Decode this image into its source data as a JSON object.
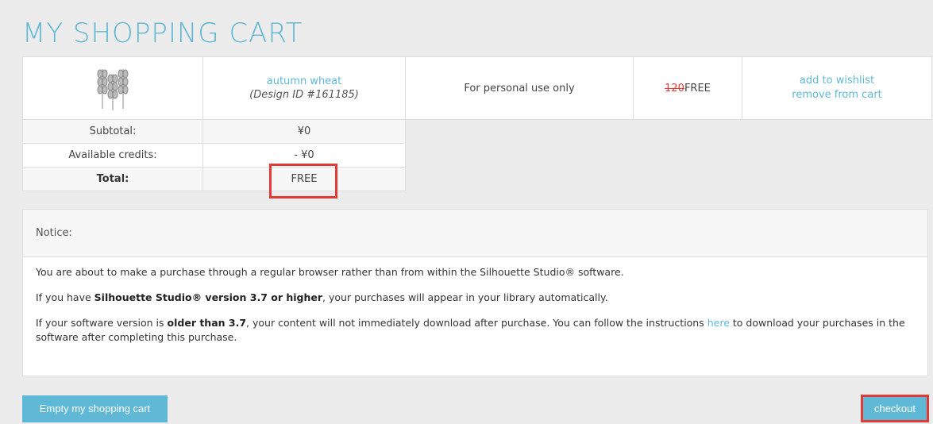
{
  "page": {
    "title": "MY SHOPPING CART"
  },
  "cart": {
    "item": {
      "thumbnail_icon": "wheat-icon",
      "name": "autumn wheat",
      "design_id": "(Design ID #161185)",
      "license": "For personal use only",
      "old_price": "120",
      "price": "FREE",
      "wishlist_link": "add to wishlist",
      "remove_link": "remove from cart"
    },
    "summary": {
      "subtotal_label": "Subtotal:",
      "subtotal_value": "¥0",
      "credits_label": "Available credits:",
      "credits_value": "- ¥0",
      "total_label": "Total:",
      "total_value": "FREE"
    }
  },
  "notice": {
    "heading": "Notice:",
    "p1": "You are about to make a purchase through a regular browser rather than from within the Silhouette Studio® software.",
    "p2_pre": "If you have ",
    "p2_bold": "Silhouette Studio® version 3.7 or higher",
    "p2_post": ", your purchases will appear in your library automatically.",
    "p3_pre": "If your software version is ",
    "p3_bold": "older than 3.7",
    "p3_mid": ", your content will not immediately download after purchase. You can follow the instructions ",
    "p3_link": "here",
    "p3_post": " to download your purchases in the software after completing this purchase."
  },
  "buttons": {
    "empty_cart": "Empty my shopping cart",
    "checkout": "checkout"
  },
  "colors": {
    "accent": "#5fb8d6",
    "highlight": "#e53935"
  }
}
